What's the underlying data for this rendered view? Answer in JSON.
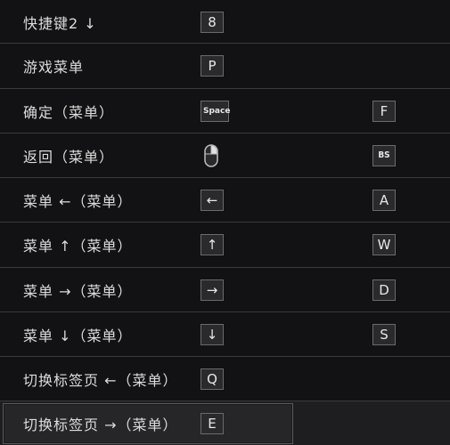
{
  "rows": [
    {
      "label": "快捷键2 ↓",
      "primary": "8",
      "secondary": ""
    },
    {
      "label": "游戏菜单",
      "primary": "P",
      "secondary": ""
    },
    {
      "label": "确定（菜单）",
      "primary": "Space",
      "secondary": "F"
    },
    {
      "label": "返回（菜单）",
      "primary": "",
      "primary_icon": "mouse-right-click-icon",
      "secondary": "BS"
    },
    {
      "label": "菜单 ←（菜单）",
      "primary": "←",
      "secondary": "A"
    },
    {
      "label": "菜单 ↑（菜单）",
      "primary": "↑",
      "secondary": "W"
    },
    {
      "label": "菜单 →（菜单）",
      "primary": "→",
      "secondary": "D"
    },
    {
      "label": "菜单 ↓（菜单）",
      "primary": "↓",
      "secondary": "S"
    },
    {
      "label": "切换标签页 ←（菜单）",
      "primary": "Q",
      "secondary": ""
    },
    {
      "label": "切换标签页 →（菜单）",
      "primary": "E",
      "secondary": ""
    }
  ],
  "selected_row_index": 9,
  "colors": {
    "background": "#121214",
    "divider": "#3a3a3c",
    "key_border": "#6a6a6c",
    "selected_background": "#262628"
  }
}
